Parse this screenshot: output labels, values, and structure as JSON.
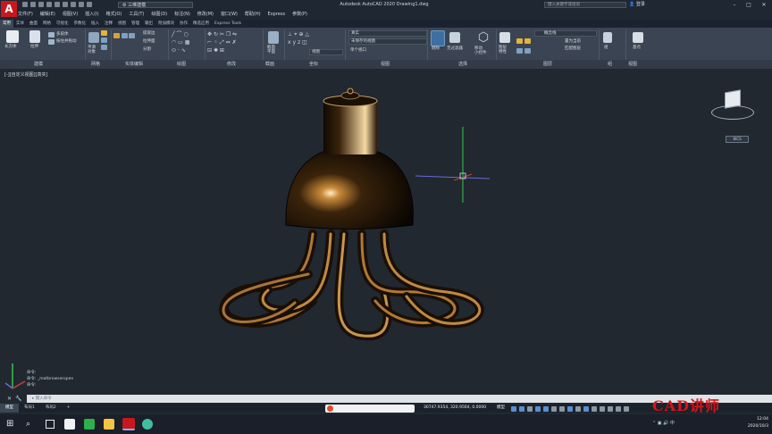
{
  "app": {
    "title": "Autodesk AutoCAD 2020    Drawing1.dwg",
    "logo_letter": "A",
    "workspace": "三维建模",
    "search_placeholder": "键入关键字或短语",
    "login": "登录"
  },
  "menu": [
    "文件(F)",
    "编辑(E)",
    "视图(V)",
    "插入(I)",
    "格式(O)",
    "工具(T)",
    "绘图(D)",
    "标注(N)",
    "修改(M)",
    "窗口(W)",
    "帮助(H)",
    "Express",
    "参数(P)"
  ],
  "ribbon_tabs": [
    {
      "label": "常用",
      "active": true
    },
    {
      "label": "实体"
    },
    {
      "label": "曲面"
    },
    {
      "label": "网格"
    },
    {
      "label": "可视化"
    },
    {
      "label": "参数化"
    },
    {
      "label": "插入"
    },
    {
      "label": "注释"
    },
    {
      "label": "视图"
    },
    {
      "label": "管理"
    },
    {
      "label": "输出"
    },
    {
      "label": "附加模块"
    },
    {
      "label": "协作"
    },
    {
      "label": "精选应用"
    },
    {
      "label": "Express Tools"
    }
  ],
  "ribbon_buttons": {
    "box": "长方体",
    "extrude": "拉伸",
    "polysolid": "多段体",
    "presspull": "按住并拖动",
    "smooth": "平滑\n对象",
    "extract_edges": "提取边",
    "extrude_face": "拉伸面",
    "separate": "分割",
    "section_plane": "截面\n平面",
    "layer_state": "未保存的图层",
    "viewport": "单个视口",
    "visual_style": "真实",
    "view_state": "未保存的视图",
    "view_fix": "视图",
    "culling": "剔除",
    "no_filter": "无过滤器",
    "gizmo": "移动\n小控件",
    "layer_props": "图层\n特性",
    "layer_name": "概念线",
    "match_layer": "置为当前",
    "match_layer2": "匹配图层",
    "group": "组",
    "base_point": "基点"
  },
  "ribbon_panels": [
    {
      "label": "建模"
    },
    {
      "label": "网格"
    },
    {
      "label": "实体编辑"
    },
    {
      "label": "绘图"
    },
    {
      "label": "修改"
    },
    {
      "label": "截面"
    },
    {
      "label": "坐标"
    },
    {
      "label": "视图"
    },
    {
      "label": "选择"
    },
    {
      "label": "图层"
    },
    {
      "label": "组"
    },
    {
      "label": "视图"
    }
  ],
  "viewport": {
    "label": "[-][自定义视图][真实]",
    "viewcube_label": "WCS"
  },
  "command": {
    "history": [
      "命令:",
      "命令: _matbrowseropen",
      "命令:"
    ],
    "prompt": "键入命令"
  },
  "layout_tabs": [
    {
      "label": "模型",
      "active": true
    },
    {
      "label": "布局1"
    },
    {
      "label": "布局2"
    },
    {
      "label": "+"
    }
  ],
  "status": {
    "coordinates": "30747.9354, 320.9504, 0.0000",
    "mode": "模型"
  },
  "watermark": "CAD讲师",
  "clock": {
    "time": "12:04",
    "date": "2020/10/3"
  },
  "colors": {
    "accent": "#c8171f",
    "viewport_bg": "#212830",
    "ribbon_bg": "#3b4452",
    "lamp": "#5a3a12"
  }
}
